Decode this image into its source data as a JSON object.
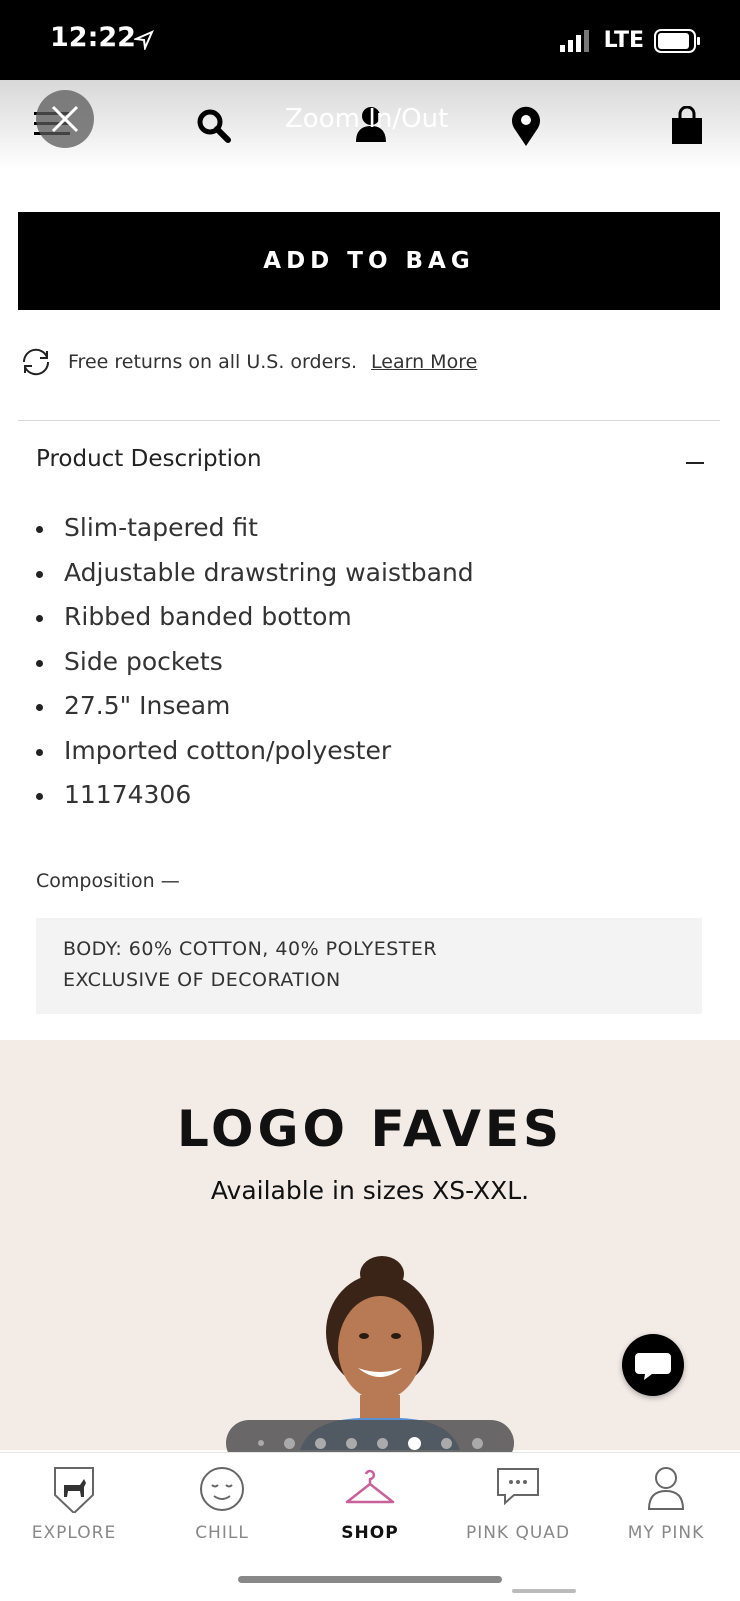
{
  "status_bar": {
    "time": "12:22",
    "network": "LTE"
  },
  "header": {
    "zoom_label": "Zoom In/Out"
  },
  "add_to_bag_label": "ADD TO BAG",
  "returns": {
    "text": "Free returns on all U.S. orders.",
    "link": "Learn More"
  },
  "product_description": {
    "title": "Product Description",
    "items": [
      "Slim-tapered fit",
      "Adjustable drawstring waistband",
      "Ribbed banded bottom",
      "Side pockets",
      "27.5\" Inseam",
      "Imported cotton/polyester",
      "11174306"
    ]
  },
  "composition": {
    "title": "Composition —",
    "lines": [
      "BODY: 60% COTTON, 40% POLYESTER",
      "EXCLUSIVE OF DECORATION"
    ]
  },
  "promo": {
    "title": "LOGO FAVES",
    "subtitle": "Available in sizes XS-XXL."
  },
  "carousel": {
    "total": 8,
    "active_index": 5
  },
  "tabbar": {
    "tabs": [
      {
        "label": "EXPLORE",
        "icon": "dog-badge-icon"
      },
      {
        "label": "CHILL",
        "icon": "smiley-icon"
      },
      {
        "label": "SHOP",
        "icon": "hanger-icon",
        "active": true
      },
      {
        "label": "PINK QUAD",
        "icon": "chat-bubble-icon"
      },
      {
        "label": "MY PINK",
        "icon": "person-icon"
      }
    ]
  },
  "colors": {
    "accent": "#c8609a",
    "promo_bg": "#f3ebe6"
  }
}
